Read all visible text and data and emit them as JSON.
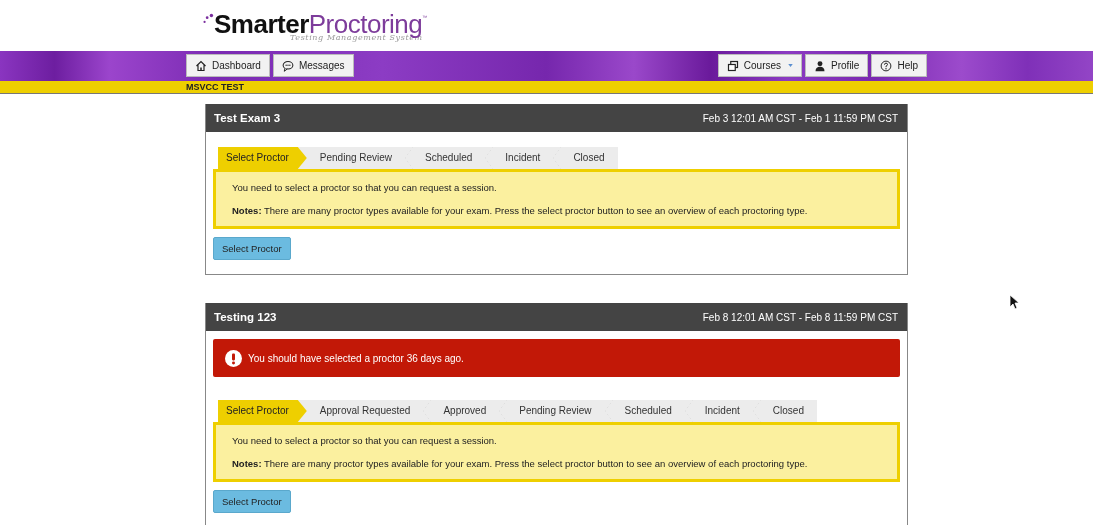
{
  "logo": {
    "first": "Smarter",
    "second": "Proctoring",
    "trademark": "™",
    "tagline": "Testing Management System"
  },
  "nav": {
    "left": [
      {
        "label": "Dashboard"
      },
      {
        "label": "Messages"
      }
    ],
    "right": [
      {
        "label": "Courses",
        "dropdown": true
      },
      {
        "label": "Profile",
        "dropdown": false
      },
      {
        "label": "Help",
        "dropdown": false
      }
    ]
  },
  "institution": "MSVCC TEST",
  "exams": [
    {
      "title": "Test Exam 3",
      "dates": "Feb 3 12:01 AM CST - Feb 1 11:59 PM CST",
      "steps": [
        {
          "label": "Select Proctor",
          "selected": true
        },
        {
          "label": "Pending Review",
          "selected": false
        },
        {
          "label": "Scheduled",
          "selected": false
        },
        {
          "label": "Incident",
          "selected": false
        },
        {
          "label": "Closed",
          "selected": false
        }
      ],
      "message": "You need to select a proctor so that you can request a session.",
      "notes": "**Notes:** There are many proctor types available for your exam. Press the select proctor button to see an overview of each proctoring type.",
      "button": "Select Proctor"
    },
    {
      "title": "Testing 123",
      "dates": "Feb 8 12:01 AM CST - Feb 8 11:59 PM CST",
      "alert": "You should have selected a proctor 36 days ago.",
      "steps": [
        {
          "label": "Select Proctor",
          "selected": true
        },
        {
          "label": "Approval Requested",
          "selected": false
        },
        {
          "label": "Approved",
          "selected": false
        },
        {
          "label": "Pending Review",
          "selected": false
        },
        {
          "label": "Scheduled",
          "selected": false
        },
        {
          "label": "Incident",
          "selected": false
        },
        {
          "label": "Closed",
          "selected": false
        }
      ],
      "message": "You need to select a proctor so that you can request a session.",
      "notes": "**Notes:** There are many proctor types available for your exam. Press the select proctor button to see an overview of each proctoring type.",
      "button": "Select Proctor"
    }
  ]
}
